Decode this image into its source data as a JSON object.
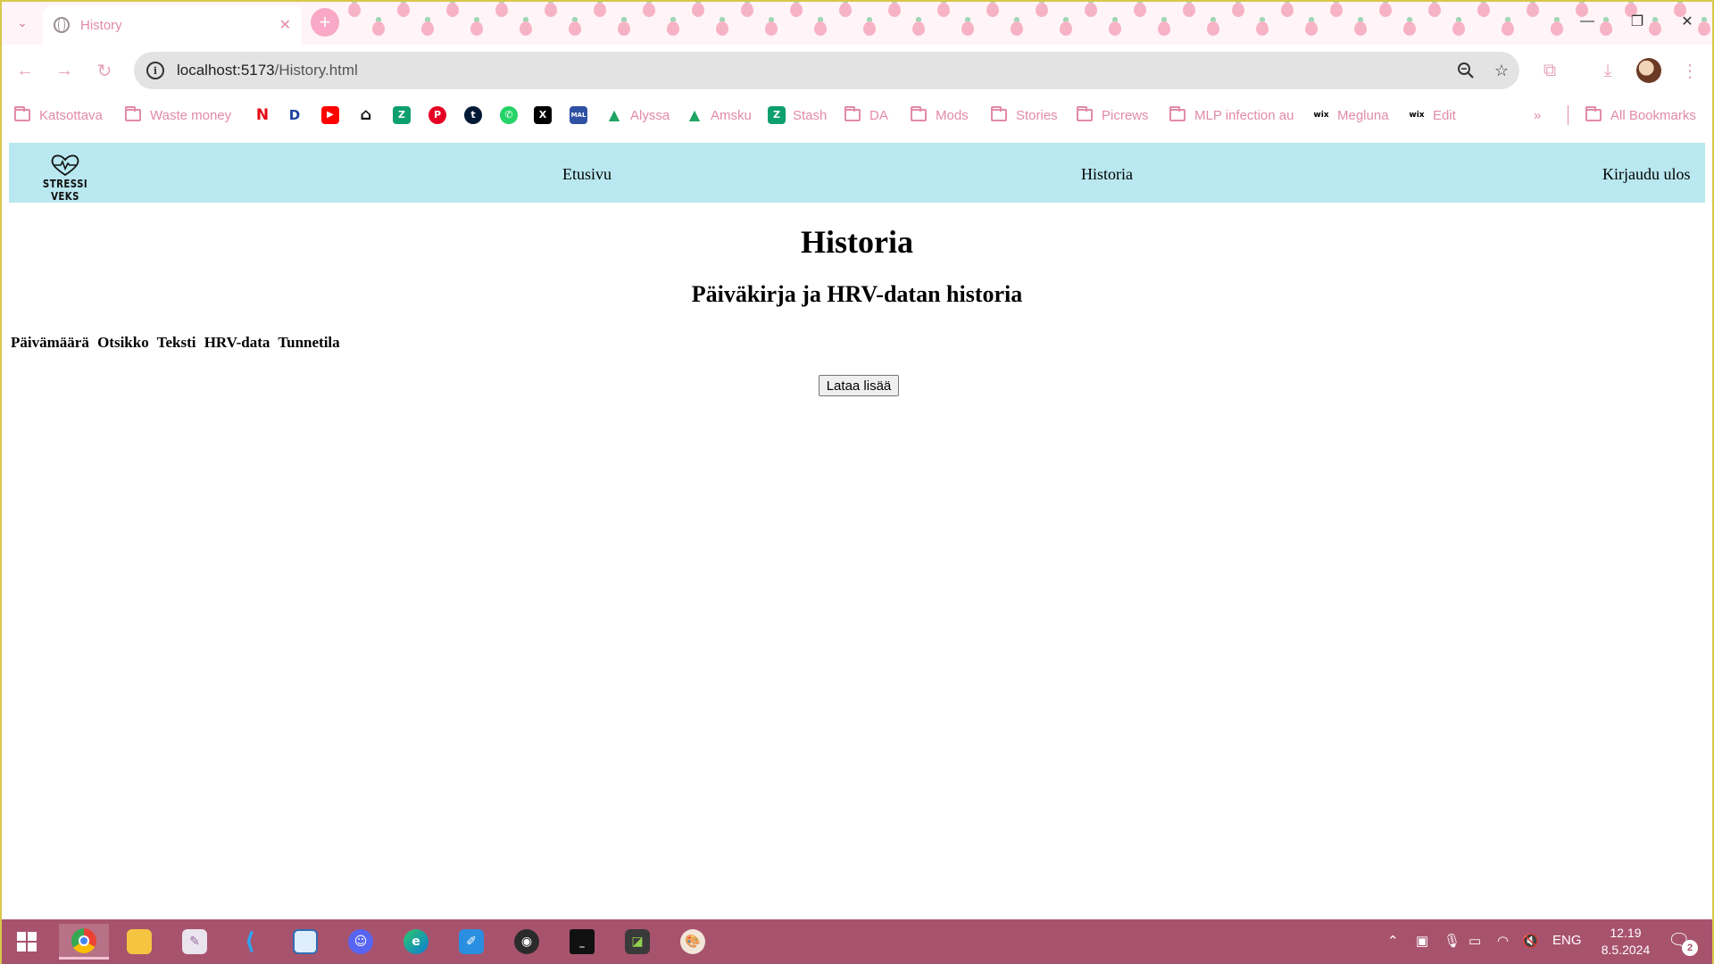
{
  "browser": {
    "tab": {
      "title": "History"
    },
    "url": {
      "host": "localhost:5173",
      "path": "/History.html"
    },
    "bookmarks": [
      {
        "label": "Katsottava",
        "kind": "folder"
      },
      {
        "label": "Waste money",
        "kind": "folder"
      },
      {
        "label": "",
        "kind": "site",
        "icon": "netflix-icon",
        "glyph": "N",
        "color": "#e50914"
      },
      {
        "label": "",
        "kind": "site",
        "icon": "disney-plus-icon",
        "glyph": "D",
        "color": "#1b3fa0"
      },
      {
        "label": "",
        "kind": "site",
        "icon": "youtube-icon",
        "glyph": "▶",
        "color": "#ff0000"
      },
      {
        "label": "",
        "kind": "site",
        "icon": "home-icon",
        "glyph": "⌂",
        "color": "#111111"
      },
      {
        "label": "",
        "kind": "site",
        "icon": "stash-icon",
        "glyph": "Z",
        "color": "#0e9f6e"
      },
      {
        "label": "",
        "kind": "site",
        "icon": "pinterest-icon",
        "glyph": "P",
        "color": "#e60023"
      },
      {
        "label": "",
        "kind": "site",
        "icon": "tumblr-icon",
        "glyph": "t",
        "color": "#001935"
      },
      {
        "label": "",
        "kind": "site",
        "icon": "whatsapp-icon",
        "glyph": "✆",
        "color": "#25d366"
      },
      {
        "label": "",
        "kind": "site",
        "icon": "x-icon",
        "glyph": "X",
        "color": "#000000"
      },
      {
        "label": "",
        "kind": "site",
        "icon": "myanimelist-icon",
        "glyph": "MAL",
        "color": "#2e51a2"
      },
      {
        "label": "Alyssa",
        "kind": "site",
        "icon": "google-drive-icon",
        "glyph": "▲",
        "color": "#1fa463"
      },
      {
        "label": "Amsku",
        "kind": "site",
        "icon": "google-drive-icon",
        "glyph": "▲",
        "color": "#1fa463"
      },
      {
        "label": "Stash",
        "kind": "site",
        "icon": "stash-icon",
        "glyph": "Z",
        "color": "#0e9f6e"
      },
      {
        "label": "DA",
        "kind": "folder"
      },
      {
        "label": "Mods",
        "kind": "folder"
      },
      {
        "label": "Stories",
        "kind": "folder"
      },
      {
        "label": "Picrews",
        "kind": "folder"
      },
      {
        "label": "MLP infection au",
        "kind": "folder"
      },
      {
        "label": "Megluna",
        "kind": "site",
        "icon": "wix-icon",
        "glyph": "wix",
        "color": "#ffffff"
      },
      {
        "label": "Edit",
        "kind": "site",
        "icon": "wix-icon",
        "glyph": "wix",
        "color": "#ffffff"
      }
    ],
    "all_bookmarks": "All Bookmarks"
  },
  "site": {
    "logo_text": "STRESSI VEKS",
    "nav": {
      "home": "Etusivu",
      "history": "Historia",
      "logout": "Kirjaudu ulos"
    },
    "title": "Historia",
    "subtitle": "Päiväkirja ja HRV-datan historia",
    "table_headers": [
      "Päivämäärä",
      "Otsikko",
      "Teksti",
      "HRV-data",
      "Tunnetila"
    ],
    "load_more": "Lataa lisää"
  },
  "taskbar": {
    "apps": [
      "start",
      "chrome",
      "file-explorer",
      "paint-app",
      "vscode",
      "notepad",
      "discord",
      "edge",
      "drawing-app",
      "obs",
      "terminal",
      "capture-app",
      "paint-palette"
    ],
    "lang": "ENG",
    "time": "12.19",
    "date": "8.5.2024",
    "notifications": "2"
  },
  "colors": {
    "nav_bg": "#b9e8f0",
    "taskbar_bg": "#a8536e",
    "accent_pink": "#e28aa9"
  }
}
